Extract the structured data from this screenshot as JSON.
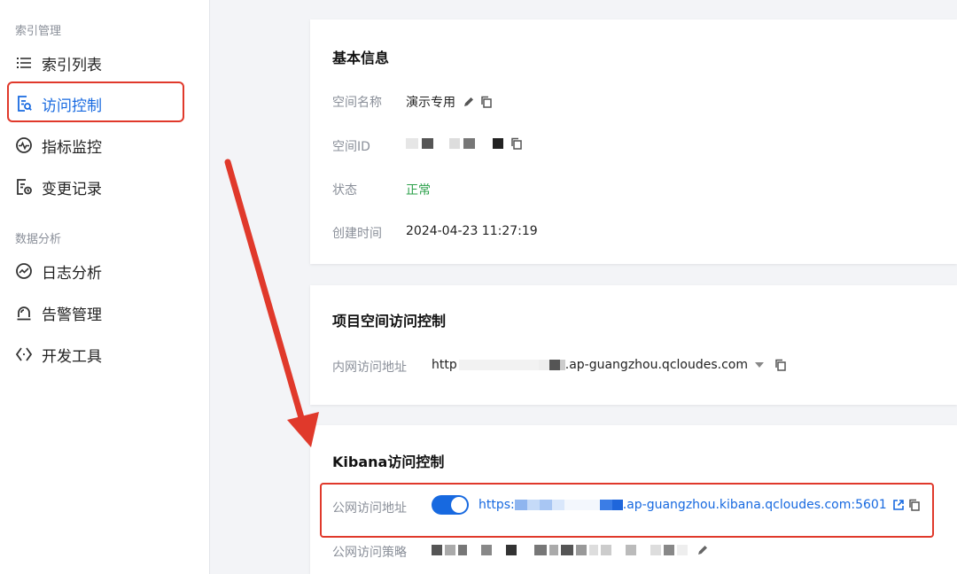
{
  "sidebar": {
    "groups": [
      {
        "label": "索引管理",
        "items": [
          {
            "label": "索引列表",
            "icon": "list-icon"
          },
          {
            "label": "访问控制",
            "icon": "access-control-icon",
            "active": true
          }
        ]
      },
      {
        "label": "",
        "items": [
          {
            "label": "指标监控",
            "icon": "monitor-icon"
          },
          {
            "label": "变更记录",
            "icon": "change-log-icon"
          }
        ]
      },
      {
        "label": "数据分析",
        "items": [
          {
            "label": "日志分析",
            "icon": "log-analysis-icon"
          },
          {
            "label": "告警管理",
            "icon": "alarm-icon"
          },
          {
            "label": "开发工具",
            "icon": "dev-tools-icon"
          }
        ]
      }
    ]
  },
  "basic": {
    "title": "基本信息",
    "space_name_label": "空间名称",
    "space_name_value": "演示专用",
    "space_id_label": "空间ID",
    "status_label": "状态",
    "status_value": "正常",
    "created_label": "创建时间",
    "created_value": "2024-04-23 11:27:19"
  },
  "project_access": {
    "title": "项目空间访问控制",
    "internal_label": "内网访问地址",
    "internal_prefix": "http",
    "internal_suffix": ".ap-guangzhou.qcloudes.com"
  },
  "kibana": {
    "title": "Kibana访问控制",
    "public_label": "公网访问地址",
    "public_enabled": true,
    "public_prefix": "https:",
    "public_suffix": ".ap-guangzhou.kibana.qcloudes.com:5601",
    "policy_label": "公网访问策略"
  },
  "colors": {
    "accent": "#1769e0",
    "status_ok": "#2ba04a",
    "highlight": "#e0392b"
  }
}
